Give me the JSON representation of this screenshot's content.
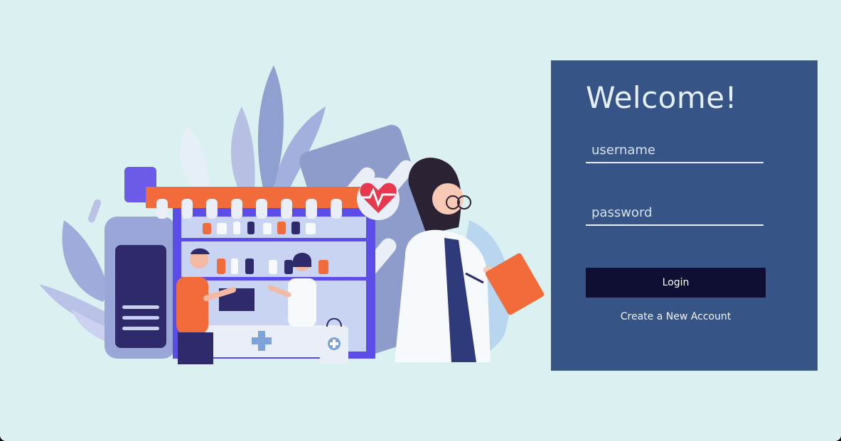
{
  "login": {
    "title": "Welcome!",
    "username_placeholder": "username",
    "password_placeholder": "password",
    "login_label": "Login",
    "create_account_label": "Create a New Account"
  },
  "colors": {
    "background": "#dbf0f0",
    "panel": "#375486",
    "login_button": "#0f0f33",
    "accent_orange": "#f26b3a",
    "accent_purple": "#5c4de8"
  }
}
